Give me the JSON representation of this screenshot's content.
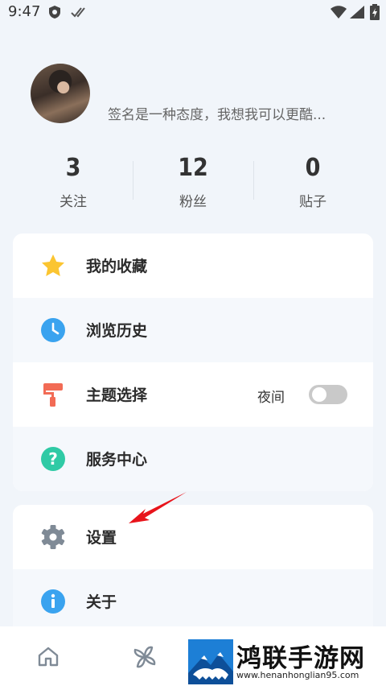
{
  "status_bar": {
    "time": "9:47"
  },
  "profile": {
    "signature": "签名是一种态度，我想我可以更酷..."
  },
  "stats": [
    {
      "value": "3",
      "label": "关注"
    },
    {
      "value": "12",
      "label": "粉丝"
    },
    {
      "value": "0",
      "label": "贴子"
    }
  ],
  "menu": {
    "favorites": "我的收藏",
    "history": "浏览历史",
    "theme": "主题选择",
    "night_label": "夜间",
    "night_mode_on": false,
    "service": "服务中心",
    "settings": "设置",
    "about": "关于"
  },
  "colors": {
    "star": "#fbc531",
    "clock": "#3aa3ef",
    "theme_icon": "#f26b55",
    "help": "#2fcaa5",
    "gear": "#7f8a96",
    "info": "#3aa3ef",
    "arrow": "#e8141b"
  },
  "icons": [
    "shield-icon",
    "double-check-icon",
    "wifi-icon",
    "signal-icon",
    "battery-icon",
    "star-icon",
    "clock-icon",
    "paint-roller-icon",
    "help-icon",
    "gear-icon",
    "info-icon",
    "home-icon",
    "pinwheel-icon"
  ],
  "watermark": {
    "title": "鸿联手游网",
    "url": "www.henanhonglian95.com"
  }
}
